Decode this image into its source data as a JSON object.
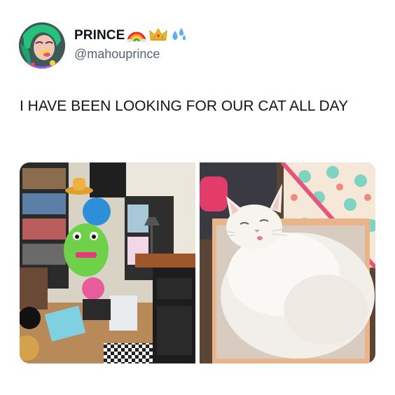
{
  "tweet": {
    "author": {
      "display_name": "PRINCE",
      "name_emojis": [
        "rainbow-icon",
        "crown-icon",
        "sweat-droplets-icon"
      ],
      "handle": "@mahouprince"
    },
    "text": "I HAVE BEEN LOOKING FOR OUR CAT ALL DAY",
    "media": [
      {
        "kind": "photo",
        "subject": "messy-room-photo"
      },
      {
        "kind": "photo",
        "subject": "white-cat-in-box-photo"
      }
    ]
  },
  "colors": {
    "text": "#0f1419",
    "secondary_text": "#536471",
    "background": "#ffffff"
  }
}
